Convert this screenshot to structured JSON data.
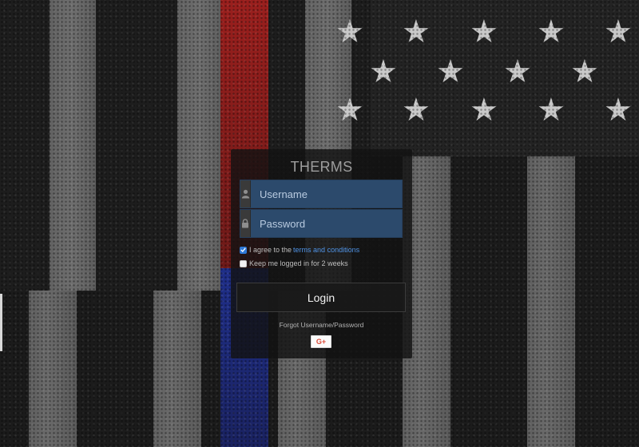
{
  "app": {
    "title": "THERMS"
  },
  "form": {
    "username": {
      "placeholder": "Username",
      "value": "",
      "icon": "user-icon"
    },
    "password": {
      "placeholder": "Password",
      "value": "",
      "icon": "lock-icon"
    },
    "agree": {
      "checked": true,
      "label": "I agree to the",
      "link": "terms and conditions"
    },
    "remember": {
      "checked": false,
      "label": "Keep me logged in for 2 weeks"
    },
    "login_label": "Login",
    "forgot_label": "Forgot Username/Password",
    "google_label": "G+"
  },
  "colors": {
    "field_bg": "#2c4a6c",
    "link": "#4f93e6",
    "checkbox_checked": "#2f79d6",
    "google_red": "#dd4b39"
  }
}
